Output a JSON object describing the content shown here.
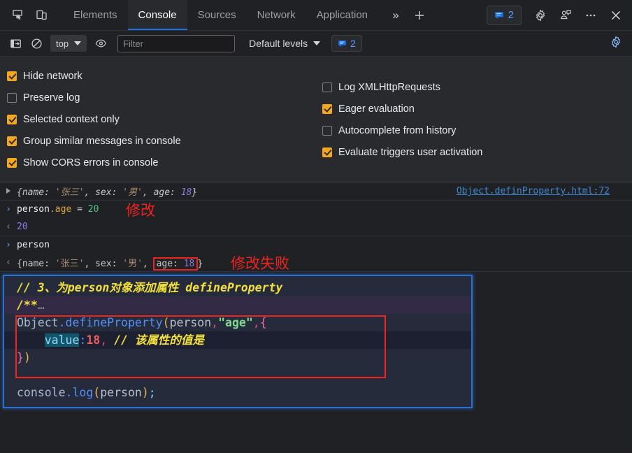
{
  "tabbar": {
    "icons": [
      {
        "name": "inspect-element-icon"
      },
      {
        "name": "device-toolbar-icon"
      }
    ],
    "tabs": [
      {
        "label": "Elements",
        "active": false
      },
      {
        "label": "Console",
        "active": true
      },
      {
        "label": "Sources",
        "active": false
      },
      {
        "label": "Network",
        "active": false
      },
      {
        "label": "Application",
        "active": false
      }
    ],
    "more_tabs_glyph": "»",
    "add_tab_glyph": "+",
    "message_count": "2",
    "settings_icon": "gear-icon",
    "customize_icon": "more-options-icon",
    "close_icon": "close-icon"
  },
  "console_toolbar": {
    "sidebar_toggle_icon": "show-console-sidebar-icon",
    "clear_icon": "clear-console-icon",
    "context": "top",
    "live_expression_icon": "create-live-expression-icon",
    "filter_placeholder": "Filter",
    "filter_value": "",
    "levels_label": "Default levels",
    "issues_count": "2",
    "settings_icon": "console-settings-gear-icon"
  },
  "settings": {
    "left_column": [
      {
        "label": "Hide network",
        "checked": true
      },
      {
        "label": "Preserve log",
        "checked": false
      },
      {
        "label": "Selected context only",
        "checked": true
      },
      {
        "label": "Group similar messages in console",
        "checked": true
      },
      {
        "label": "Show CORS errors in console",
        "checked": true
      }
    ],
    "right_column": [
      {
        "label": "Log XMLHttpRequests",
        "checked": false
      },
      {
        "label": "Eager evaluation",
        "checked": true
      },
      {
        "label": "Autocomplete from history",
        "checked": false
      },
      {
        "label": "Evaluate triggers user activation",
        "checked": true
      }
    ]
  },
  "console": {
    "log_row": {
      "expand_glyph": "▶",
      "open_brace": "{",
      "k1": "name: ",
      "v1": "'张三'",
      "sep1": ", ",
      "k2": "sex: ",
      "v2": "'男'",
      "sep2": ", ",
      "k3": "age: ",
      "v3": "18",
      "close_brace": "}",
      "source_link": "Object.definProperty.html:72"
    },
    "input_row_1": {
      "prompt": "›",
      "obj": "person",
      "prop": ".age",
      "op": " = ",
      "value": "20"
    },
    "output_row_1": {
      "prompt": "‹",
      "value": "20"
    },
    "input_row_2": {
      "prompt": "›",
      "text": "person"
    },
    "output_row_2": {
      "prompt": "‹",
      "open_brace": "{",
      "k1": "name: ",
      "v1": "'张三'",
      "sep1": ", ",
      "k2": "sex: ",
      "v2": "'男'",
      "sep2": ", ",
      "boxed_key": "age: ",
      "boxed_val": "18",
      "close_brace": "}"
    },
    "annotation_1": "修改",
    "annotation_2": "修改失败"
  },
  "codeblock": {
    "line1_comment": "// 3、为person对象添加属性 defineProperty",
    "line2_doc": "/**",
    "line2_dots": "…",
    "line3": {
      "obj": "Object",
      "fn": ".defineProperty",
      "paren_open": "(",
      "param": "person",
      "comma1": ",",
      "str": "\"age\"",
      "comma2": ",",
      "brace_open": "{"
    },
    "line4": {
      "indent": "    ",
      "prop": "value",
      "colon": ":",
      "num": "18",
      "comma": ",",
      "comment": " // 该属性的值是"
    },
    "line5": {
      "brace_close": "}",
      "paren_close": ")"
    },
    "line7": {
      "obj": "console",
      "fn": ".log",
      "paren_open": "(",
      "param": "person",
      "paren_close": ")",
      "semi": ";"
    }
  },
  "colors": {
    "accent_blue": "#1a73e8",
    "checkbox_on": "#f5a623",
    "annotation_red": "#f1231f",
    "codeblock_border": "#2a6fd1",
    "link_blue": "#3b87d4"
  }
}
